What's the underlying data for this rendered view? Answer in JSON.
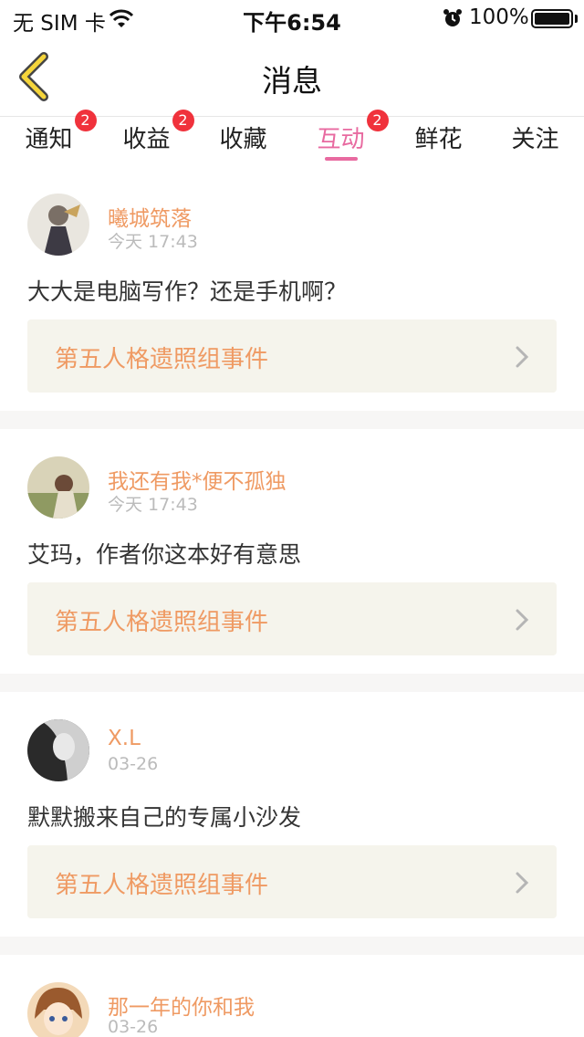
{
  "status_bar": {
    "carrier": "无 SIM 卡",
    "time": "下午6:54",
    "battery": "100%",
    "icons": [
      "wifi-icon",
      "alarm-icon",
      "battery-icon"
    ]
  },
  "nav": {
    "title": "消息",
    "back_icon": "chevron-left-icon"
  },
  "tabs": [
    {
      "label": "通知",
      "badge": "2"
    },
    {
      "label": "收益",
      "badge": "2"
    },
    {
      "label": "收藏",
      "badge": ""
    },
    {
      "label": "互动",
      "badge": "2",
      "active": true
    },
    {
      "label": "鲜花",
      "badge": ""
    },
    {
      "label": "关注",
      "badge": ""
    }
  ],
  "messages": [
    {
      "user": "曦城筑落",
      "time": "今天 17:43",
      "comment": "大大是电脑写作？还是手机啊？",
      "book": "第五人格遗照组事件"
    },
    {
      "user": "我还有我*便不孤独",
      "time": "今天 17:43",
      "comment": "艾玛，作者你这本好有意思",
      "book": "第五人格遗照组事件"
    },
    {
      "user": "X.L",
      "time": "03-26",
      "comment": "默默搬来自己的专属小沙发",
      "book": "第五人格遗照组事件"
    },
    {
      "user": "那一年的你和我",
      "time": "03-26",
      "comment": "",
      "book": ""
    }
  ],
  "colors": {
    "accent_pink": "#e86aa0",
    "username_orange": "#ef9a63",
    "badge_red": "#f0323c",
    "back_yellow": "#f5d53b",
    "book_bg": "#f5f4ec"
  }
}
